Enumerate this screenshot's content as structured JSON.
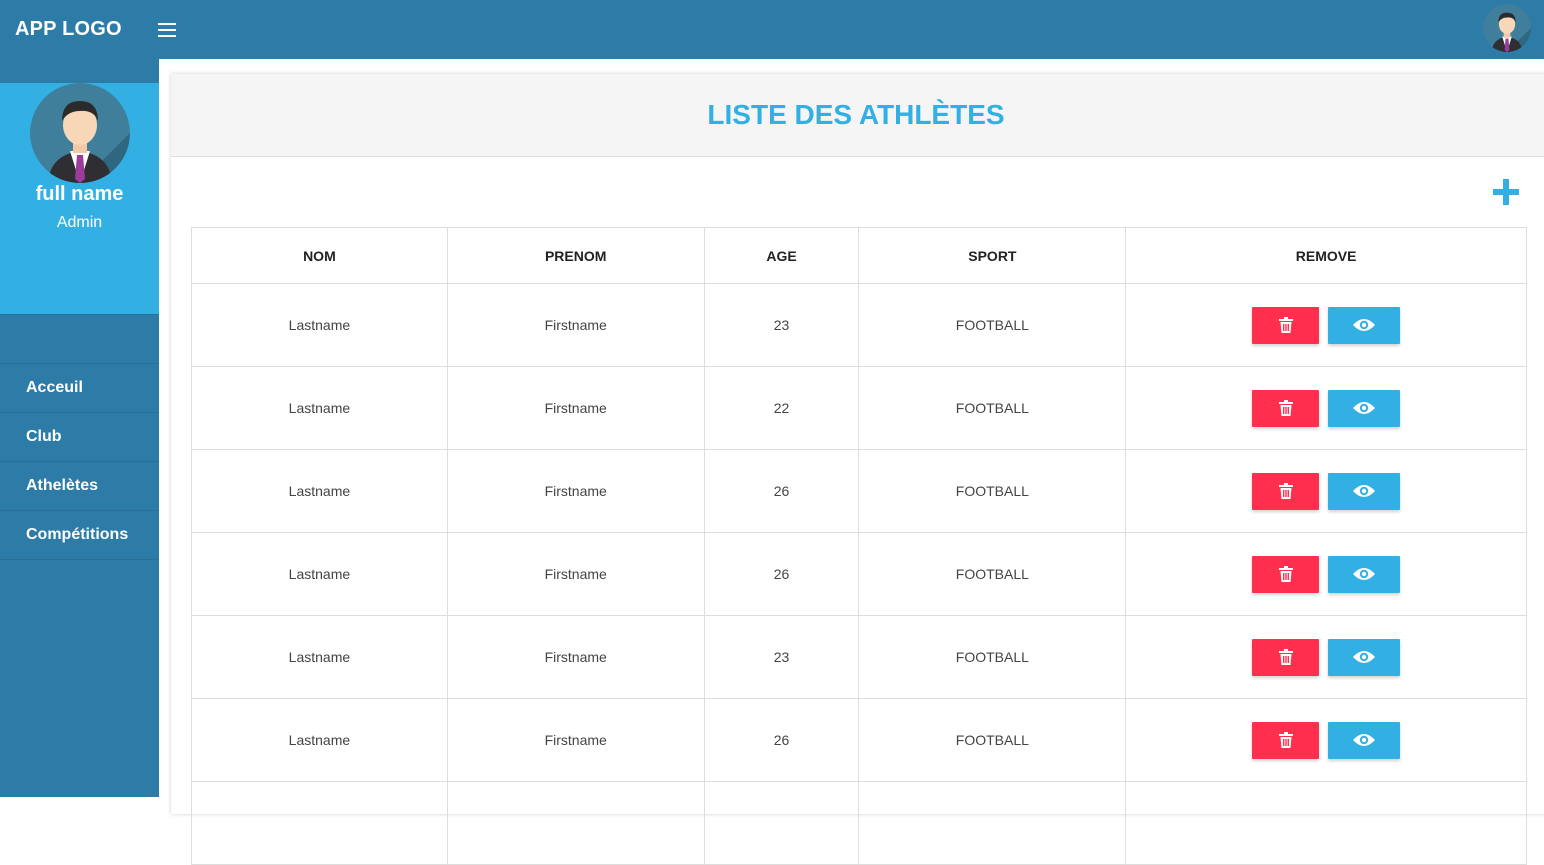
{
  "topbar": {
    "logo": "APP LOGO",
    "menu_icon": "hamburger-menu-icon",
    "avatar_icon": "user-avatar-icon"
  },
  "sidebar": {
    "profile": {
      "name": "full name",
      "role": "Admin"
    },
    "items": [
      {
        "label": "Acceuil"
      },
      {
        "label": "Club"
      },
      {
        "label": "Athelètes"
      },
      {
        "label": "Compétitions"
      }
    ]
  },
  "main": {
    "title": "LISTE DES ATHLÈTES",
    "add_icon": "plus-icon",
    "table": {
      "headers": [
        "NOM",
        "PRENOM",
        "AGE",
        "SPORT",
        "REMOVE"
      ],
      "rows": [
        {
          "nom": "Lastname",
          "prenom": "Firstname",
          "age": "23",
          "sport": "FOOTBALL"
        },
        {
          "nom": "Lastname",
          "prenom": "Firstname",
          "age": "22",
          "sport": "FOOTBALL"
        },
        {
          "nom": "Lastname",
          "prenom": "Firstname",
          "age": "26",
          "sport": "FOOTBALL"
        },
        {
          "nom": "Lastname",
          "prenom": "Firstname",
          "age": "26",
          "sport": "FOOTBALL"
        },
        {
          "nom": "Lastname",
          "prenom": "Firstname",
          "age": "23",
          "sport": "FOOTBALL"
        },
        {
          "nom": "Lastname",
          "prenom": "Firstname",
          "age": "26",
          "sport": "FOOTBALL"
        }
      ]
    }
  },
  "colors": {
    "topbar": "#2d7ca8",
    "profile_bg": "#33b0e3",
    "accent": "#33b0e3",
    "danger": "#ff2f4d"
  }
}
